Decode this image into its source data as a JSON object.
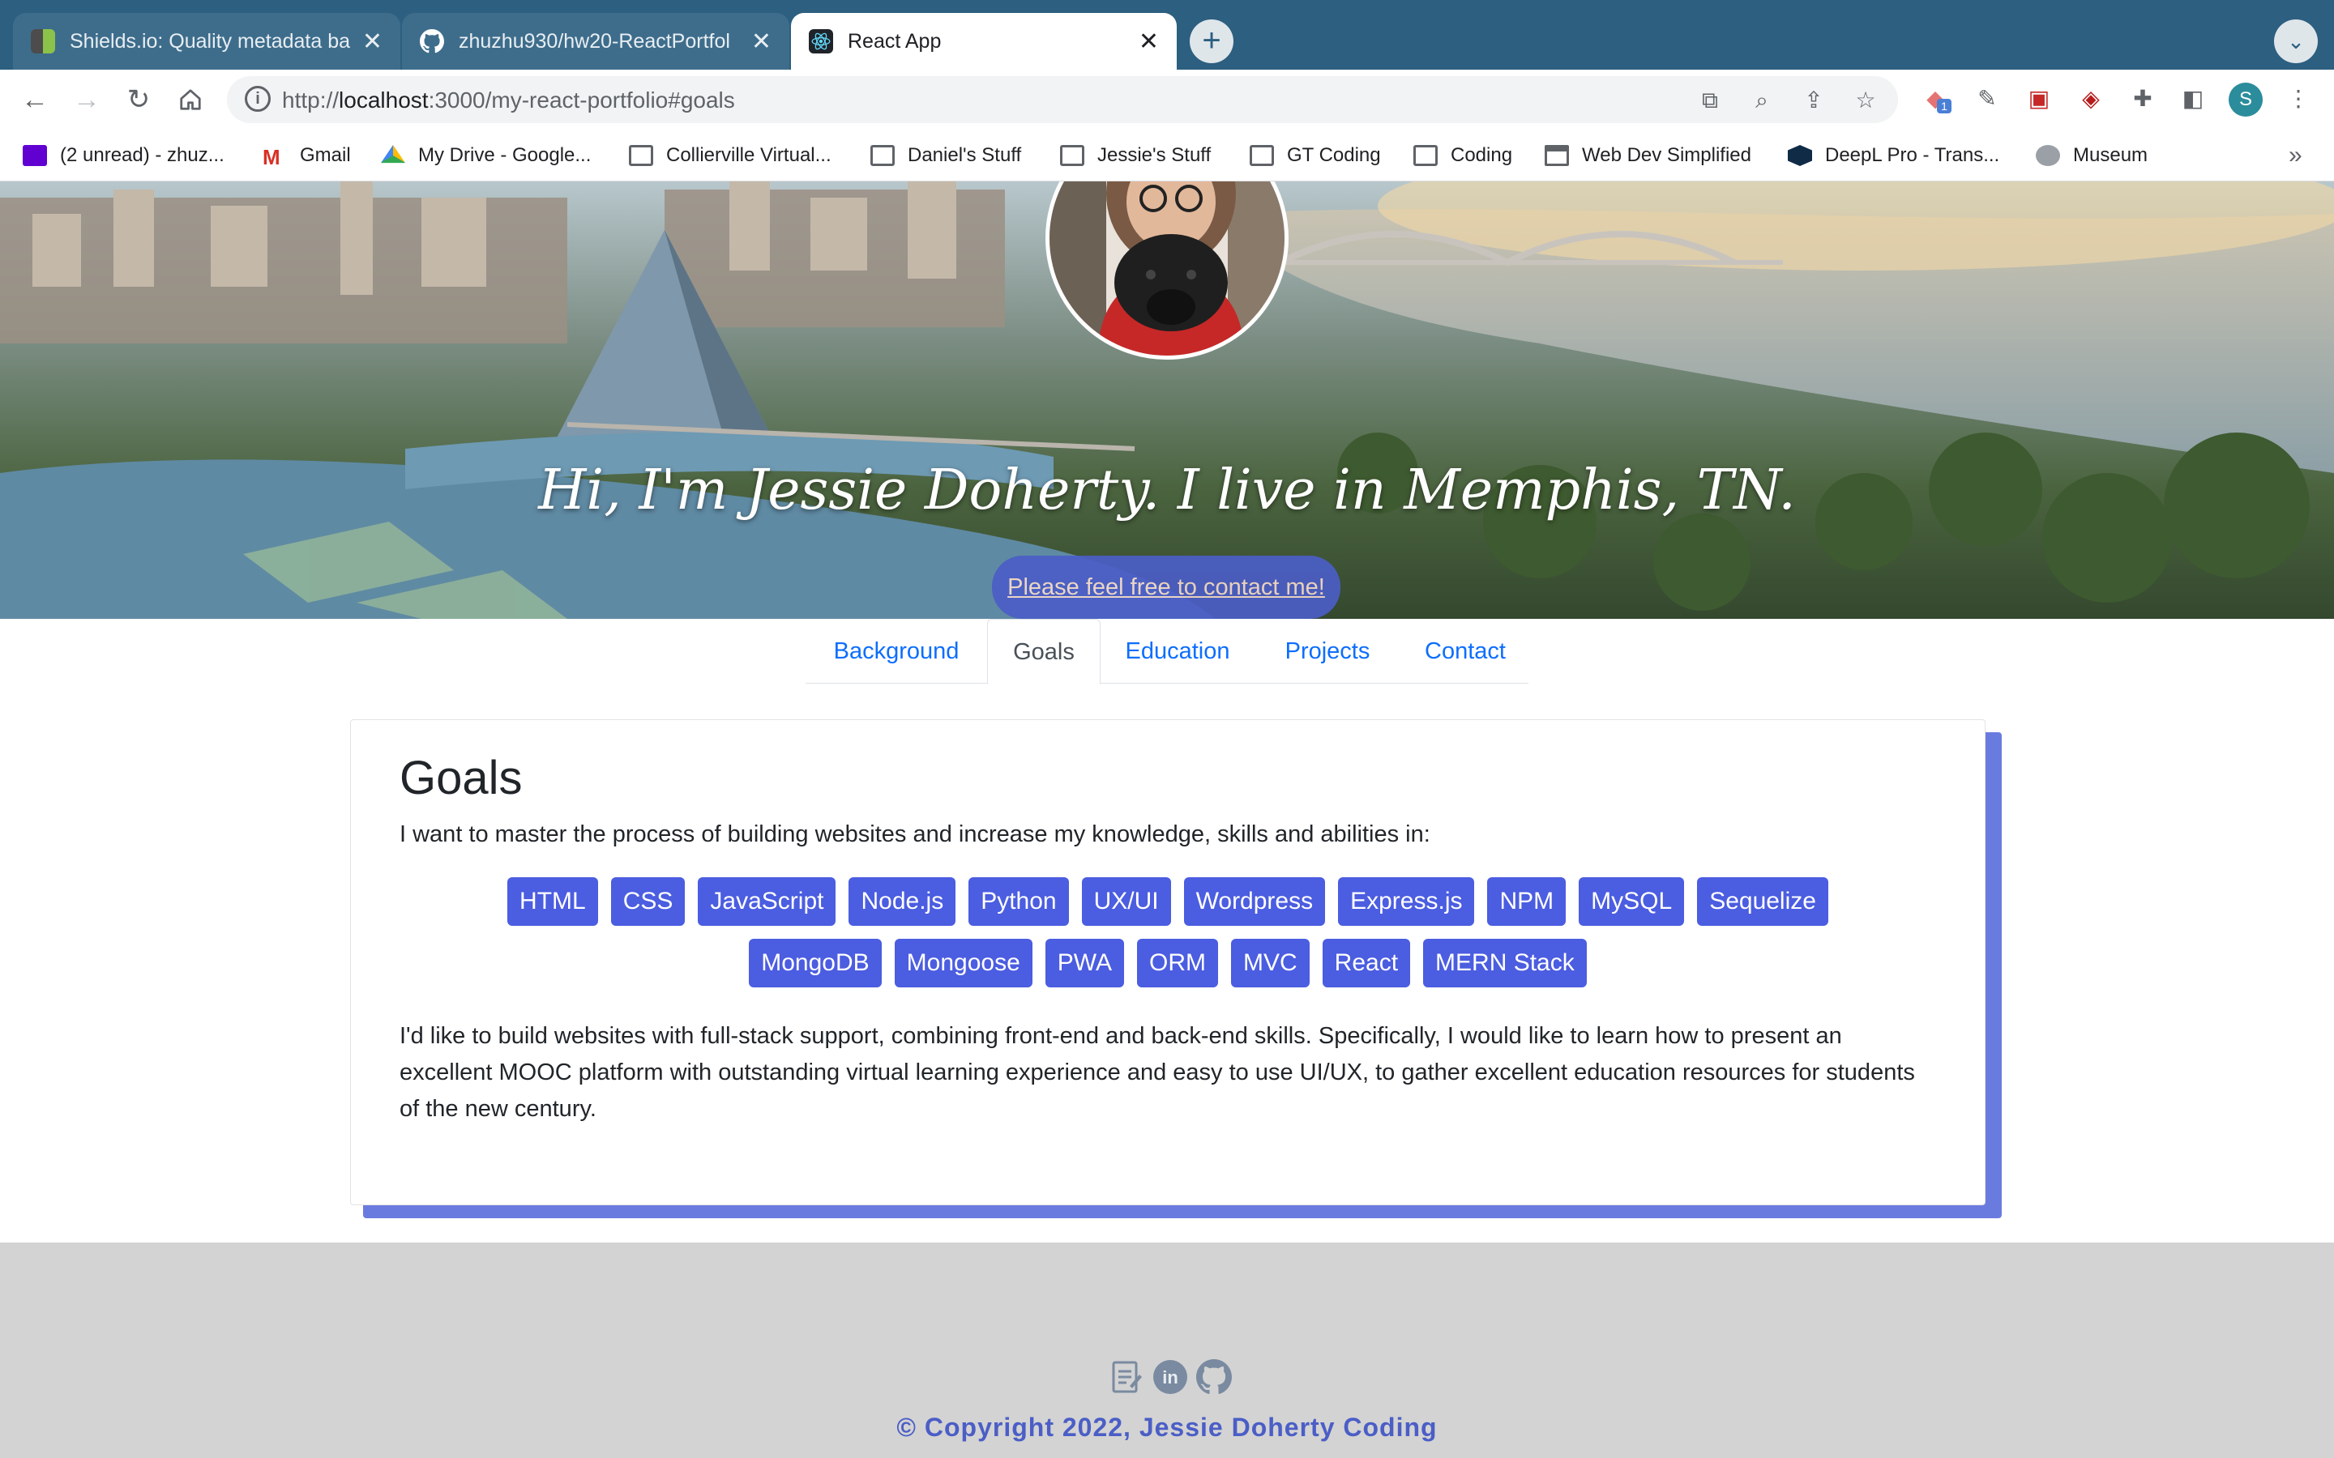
{
  "browser": {
    "tabs": [
      {
        "title": "Shields.io: Quality metadata ba",
        "icon": "shields-icon",
        "active": false
      },
      {
        "title": "zhuzhu930/hw20-ReactPortfol",
        "icon": "github-icon",
        "active": false
      },
      {
        "title": "React App",
        "icon": "react-icon",
        "active": true
      }
    ],
    "close_glyph": "✕",
    "new_tab_glyph": "+",
    "url_prefix": "http://",
    "url_host": "localhost",
    "url_rest": ":3000/my-react-portfolio#goals",
    "profile_initial": "S",
    "extension_badge": "1",
    "bookmarks": [
      {
        "label": "(2 unread) - zhuz...",
        "icon": "yahoo-mail-icon"
      },
      {
        "label": "Gmail",
        "icon": "gmail-icon"
      },
      {
        "label": "My Drive - Google...",
        "icon": "google-drive-icon"
      },
      {
        "label": "Collierville Virtual...",
        "icon": "folder-icon"
      },
      {
        "label": "Daniel's Stuff",
        "icon": "folder-icon"
      },
      {
        "label": "Jessie's Stuff",
        "icon": "folder-icon"
      },
      {
        "label": "GT Coding",
        "icon": "folder-icon"
      },
      {
        "label": "Coding",
        "icon": "folder-icon"
      },
      {
        "label": "Web Dev Simplified",
        "icon": "webpage-icon"
      },
      {
        "label": "DeepL Pro - Trans...",
        "icon": "deepl-icon"
      },
      {
        "label": "Museum",
        "icon": "globe-icon"
      }
    ],
    "bookmarks_overflow": "»"
  },
  "hero": {
    "title": "Hi, I'm Jessie Doherty. I live in Memphis, TN.",
    "contact_link": "Please feel free to contact me!"
  },
  "nav": {
    "tabs": [
      "Background",
      "Goals",
      "Education",
      "Projects",
      "Contact"
    ],
    "active": "Goals"
  },
  "goals": {
    "title": "Goals",
    "intro": "I want to master the process of building websites and increase my knowledge, skills and abilities in:",
    "skills": [
      "HTML",
      "CSS",
      "JavaScript",
      "Node.js",
      "Python",
      "UX/UI",
      "Wordpress",
      "Express.js",
      "NPM",
      "MySQL",
      "Sequelize",
      "MongoDB",
      "Mongoose",
      "PWA",
      "ORM",
      "MVC",
      "React",
      "MERN Stack"
    ],
    "paragraph": "I'd like to build websites with full-stack support, combining front-end and back-end skills. Specifically, I would like to learn how to present an excellent MOOC platform with outstanding virtual learning experience and easy to use UI/UX, to gather excellent education resources for students of the new century."
  },
  "footer": {
    "icons": [
      "resume-icon",
      "linkedin-icon",
      "github-icon"
    ],
    "copyright": "© Copyright 2022, Jessie Doherty Coding"
  },
  "colors": {
    "accent": "#4b5de0",
    "tab_bar": "#2c5f80",
    "footer_bg": "#d3d3d3",
    "link": "#0d6efd"
  }
}
